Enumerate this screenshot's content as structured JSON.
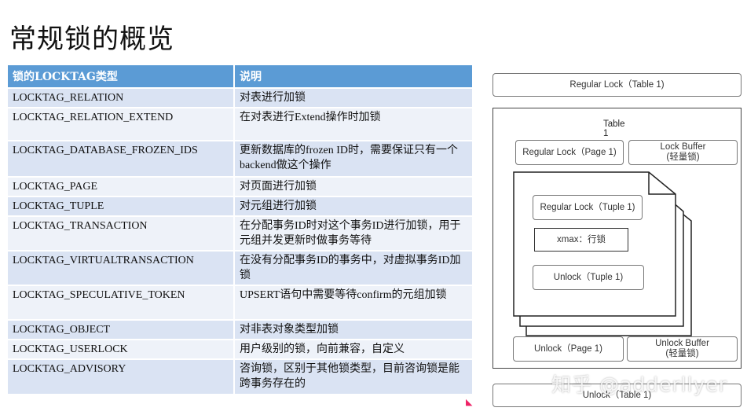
{
  "title": "常规锁的概览",
  "table": {
    "headers": [
      "锁的LOCKTAG类型",
      "说明"
    ],
    "rows": [
      {
        "tag": "LOCKTAG_RELATION",
        "desc": "对表进行加锁"
      },
      {
        "tag": "LOCKTAG_RELATION_EXTEND",
        "desc": "在对表进行Extend操作时加锁"
      },
      {
        "tag": "LOCKTAG_DATABASE_FROZEN_IDS",
        "desc": "更新数据库的frozen ID时，需要保证只有一个backend做这个操作"
      },
      {
        "tag": "LOCKTAG_PAGE",
        "desc": "对页面进行加锁"
      },
      {
        "tag": "LOCKTAG_TUPLE",
        "desc": "对元组进行加锁"
      },
      {
        "tag": "LOCKTAG_TRANSACTION",
        "desc": "在分配事务ID时对这个事务ID进行加锁，用于元组并发更新时做事务等待"
      },
      {
        "tag": "LOCKTAG_VIRTUALTRANSACTION",
        "desc": "在没有分配事务ID的事务中，对虚拟事务ID加锁"
      },
      {
        "tag": "LOCKTAG_SPECULATIVE_TOKEN",
        "desc": "UPSERT语句中需要等待confirm的元组加锁"
      },
      {
        "tag": "LOCKTAG_OBJECT",
        "desc": "对非表对象类型加锁"
      },
      {
        "tag": "LOCKTAG_USERLOCK",
        "desc": "用户级别的锁，向前兼容，自定义"
      },
      {
        "tag": "LOCKTAG_ADVISORY",
        "desc": "咨询锁，区别于其他锁类型，目前咨询锁是能跨事务存在的"
      }
    ]
  },
  "diagram": {
    "regular_lock_table": "Regular Lock（Table 1)",
    "table1_label": "Table 1",
    "regular_lock_page": "Regular Lock（Page 1)",
    "lock_buffer_top_line1": "Lock Buffer",
    "lock_buffer_top_line2": "(轻量锁)",
    "regular_lock_tuple": "Regular Lock（Tuple 1)",
    "xmax": "xmax：行锁",
    "unlock_tuple": "Unlock（Tuple 1)",
    "unlock_page": "Unlock（Page 1)",
    "unlock_buffer_line1": "Unlock Buffer",
    "unlock_buffer_line2": "(轻量锁)",
    "unlock_table": "Unlock（Table 1)"
  },
  "watermark": "知乎 @adderllyer"
}
